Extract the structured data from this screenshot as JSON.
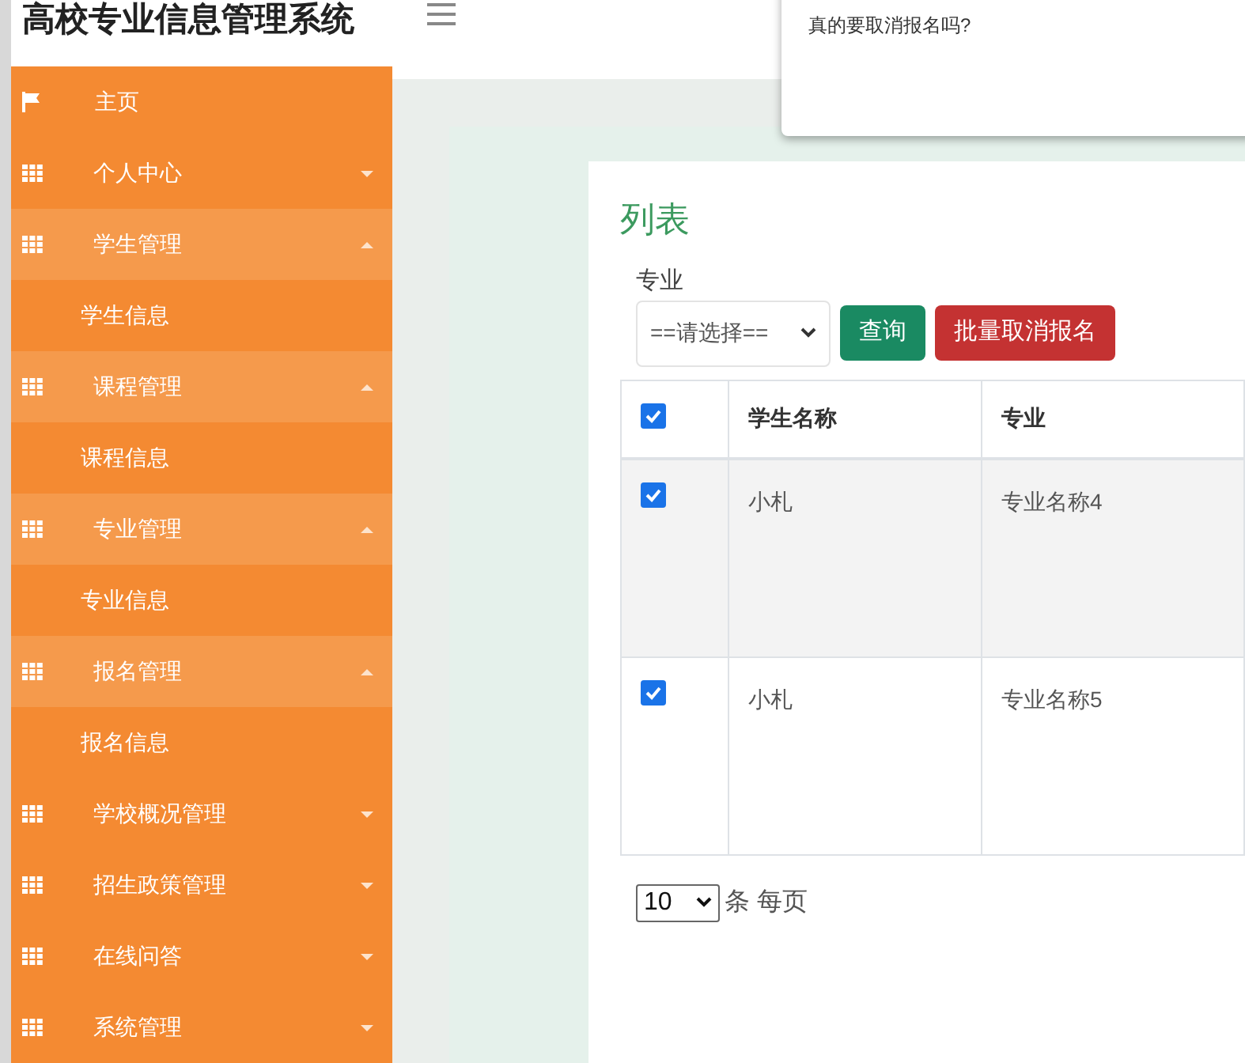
{
  "header": {
    "title": "高校专业信息管理系统"
  },
  "sidebar": {
    "items": [
      {
        "label": "主页",
        "kind": "home"
      },
      {
        "label": "个人中心",
        "kind": "menu",
        "expanded": false
      },
      {
        "label": "学生管理",
        "kind": "menu",
        "expanded": true,
        "children": [
          {
            "label": "学生信息"
          }
        ]
      },
      {
        "label": "课程管理",
        "kind": "menu",
        "expanded": true,
        "children": [
          {
            "label": "课程信息"
          }
        ]
      },
      {
        "label": "专业管理",
        "kind": "menu",
        "expanded": true,
        "children": [
          {
            "label": "专业信息"
          }
        ]
      },
      {
        "label": "报名管理",
        "kind": "menu",
        "expanded": true,
        "children": [
          {
            "label": "报名信息"
          }
        ]
      },
      {
        "label": "学校概况管理",
        "kind": "menu",
        "expanded": false
      },
      {
        "label": "招生政策管理",
        "kind": "menu",
        "expanded": false
      },
      {
        "label": "在线问答",
        "kind": "menu",
        "expanded": false
      },
      {
        "label": "系统管理",
        "kind": "menu",
        "expanded": false
      }
    ]
  },
  "dialog": {
    "message": "真的要取消报名吗?"
  },
  "card": {
    "title": "列表",
    "filter": {
      "label": "专业",
      "select_value": "==请选择=="
    },
    "buttons": [
      {
        "label": "查询",
        "kind": "primary"
      },
      {
        "label": "批量取消报名",
        "kind": "danger"
      }
    ],
    "table": {
      "all_checked": true,
      "columns": [
        "学生名称",
        "专业"
      ],
      "rows": [
        {
          "checked": true,
          "cells": [
            "小札",
            "专业名称4"
          ]
        },
        {
          "checked": true,
          "cells": [
            "小札",
            "专业名称5"
          ]
        }
      ]
    },
    "pager": {
      "page_size": "10",
      "suffix": "条 每页"
    }
  }
}
